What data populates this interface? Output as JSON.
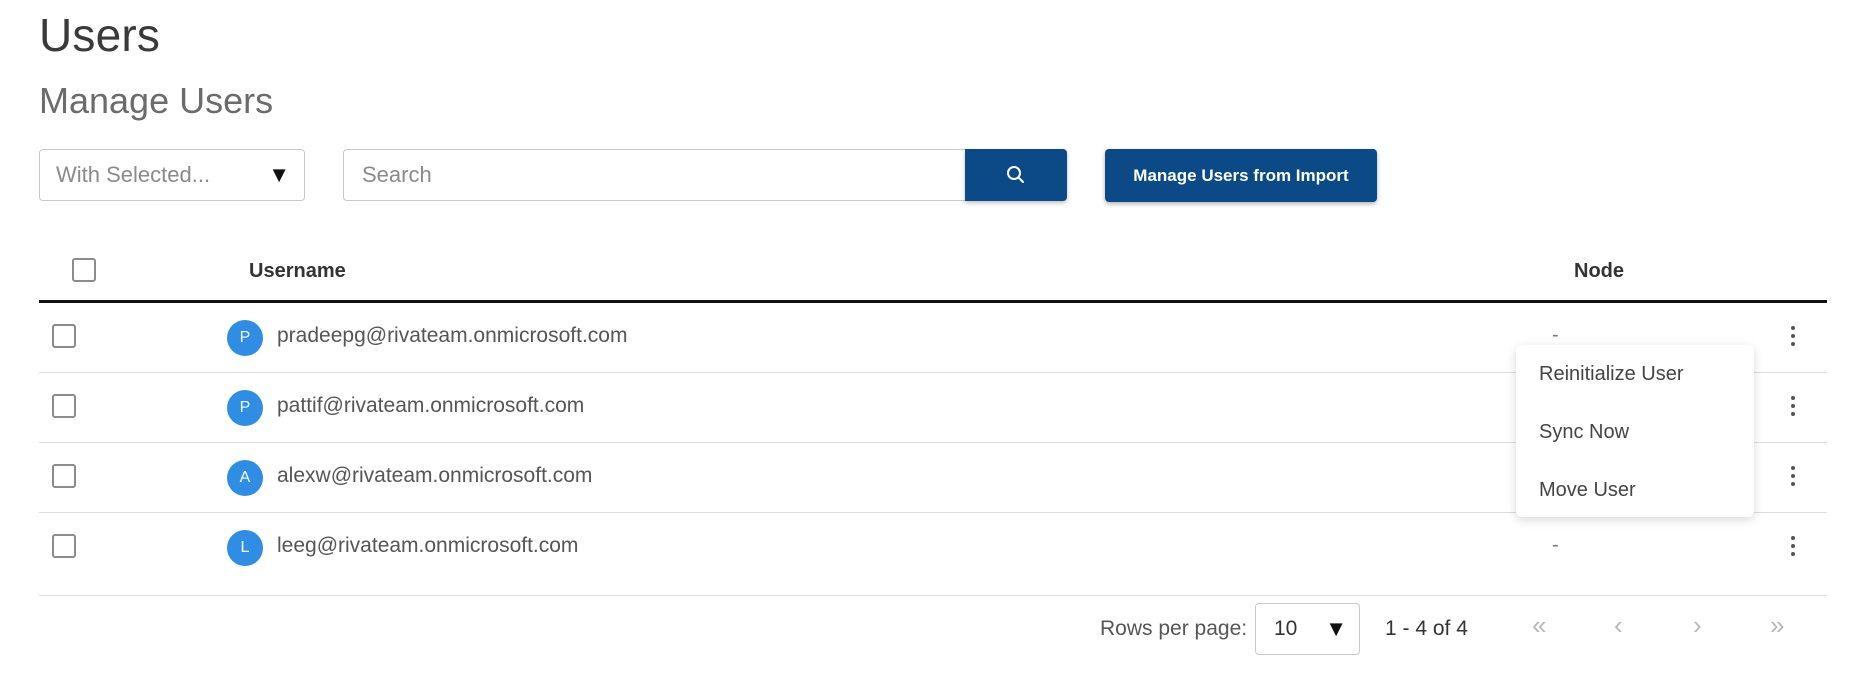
{
  "header": {
    "title": "Users",
    "subtitle": "Manage Users"
  },
  "toolbar": {
    "bulk_action_placeholder": "With Selected...",
    "search_placeholder": "Search",
    "import_button_label": "Manage Users from Import",
    "accent_color": "#0b4a86"
  },
  "table": {
    "columns": {
      "username": "Username",
      "node": "Node"
    },
    "rows": [
      {
        "initial": "P",
        "username": "pradeepg@rivateam.onmicrosoft.com",
        "node": "-"
      },
      {
        "initial": "P",
        "username": "pattif@rivateam.onmicrosoft.com",
        "node": ""
      },
      {
        "initial": "A",
        "username": "alexw@rivateam.onmicrosoft.com",
        "node": ""
      },
      {
        "initial": "L",
        "username": "leeg@rivateam.onmicrosoft.com",
        "node": "-"
      }
    ],
    "avatar_color": "#2f8de4"
  },
  "context_menu": {
    "items": [
      {
        "label": "Reinitialize User"
      },
      {
        "label": "Sync Now"
      },
      {
        "label": "Move User"
      }
    ]
  },
  "pagination": {
    "rows_per_page_label": "Rows per page:",
    "rows_per_page_value": "10",
    "range_text": "1 - 4 of 4",
    "first_icon": "«",
    "prev_icon": "‹",
    "next_icon": "›",
    "last_icon": "»"
  },
  "icons": {
    "dropdown_caret": "▼",
    "search": "search-icon",
    "row_menu": "kebab-menu-icon"
  }
}
